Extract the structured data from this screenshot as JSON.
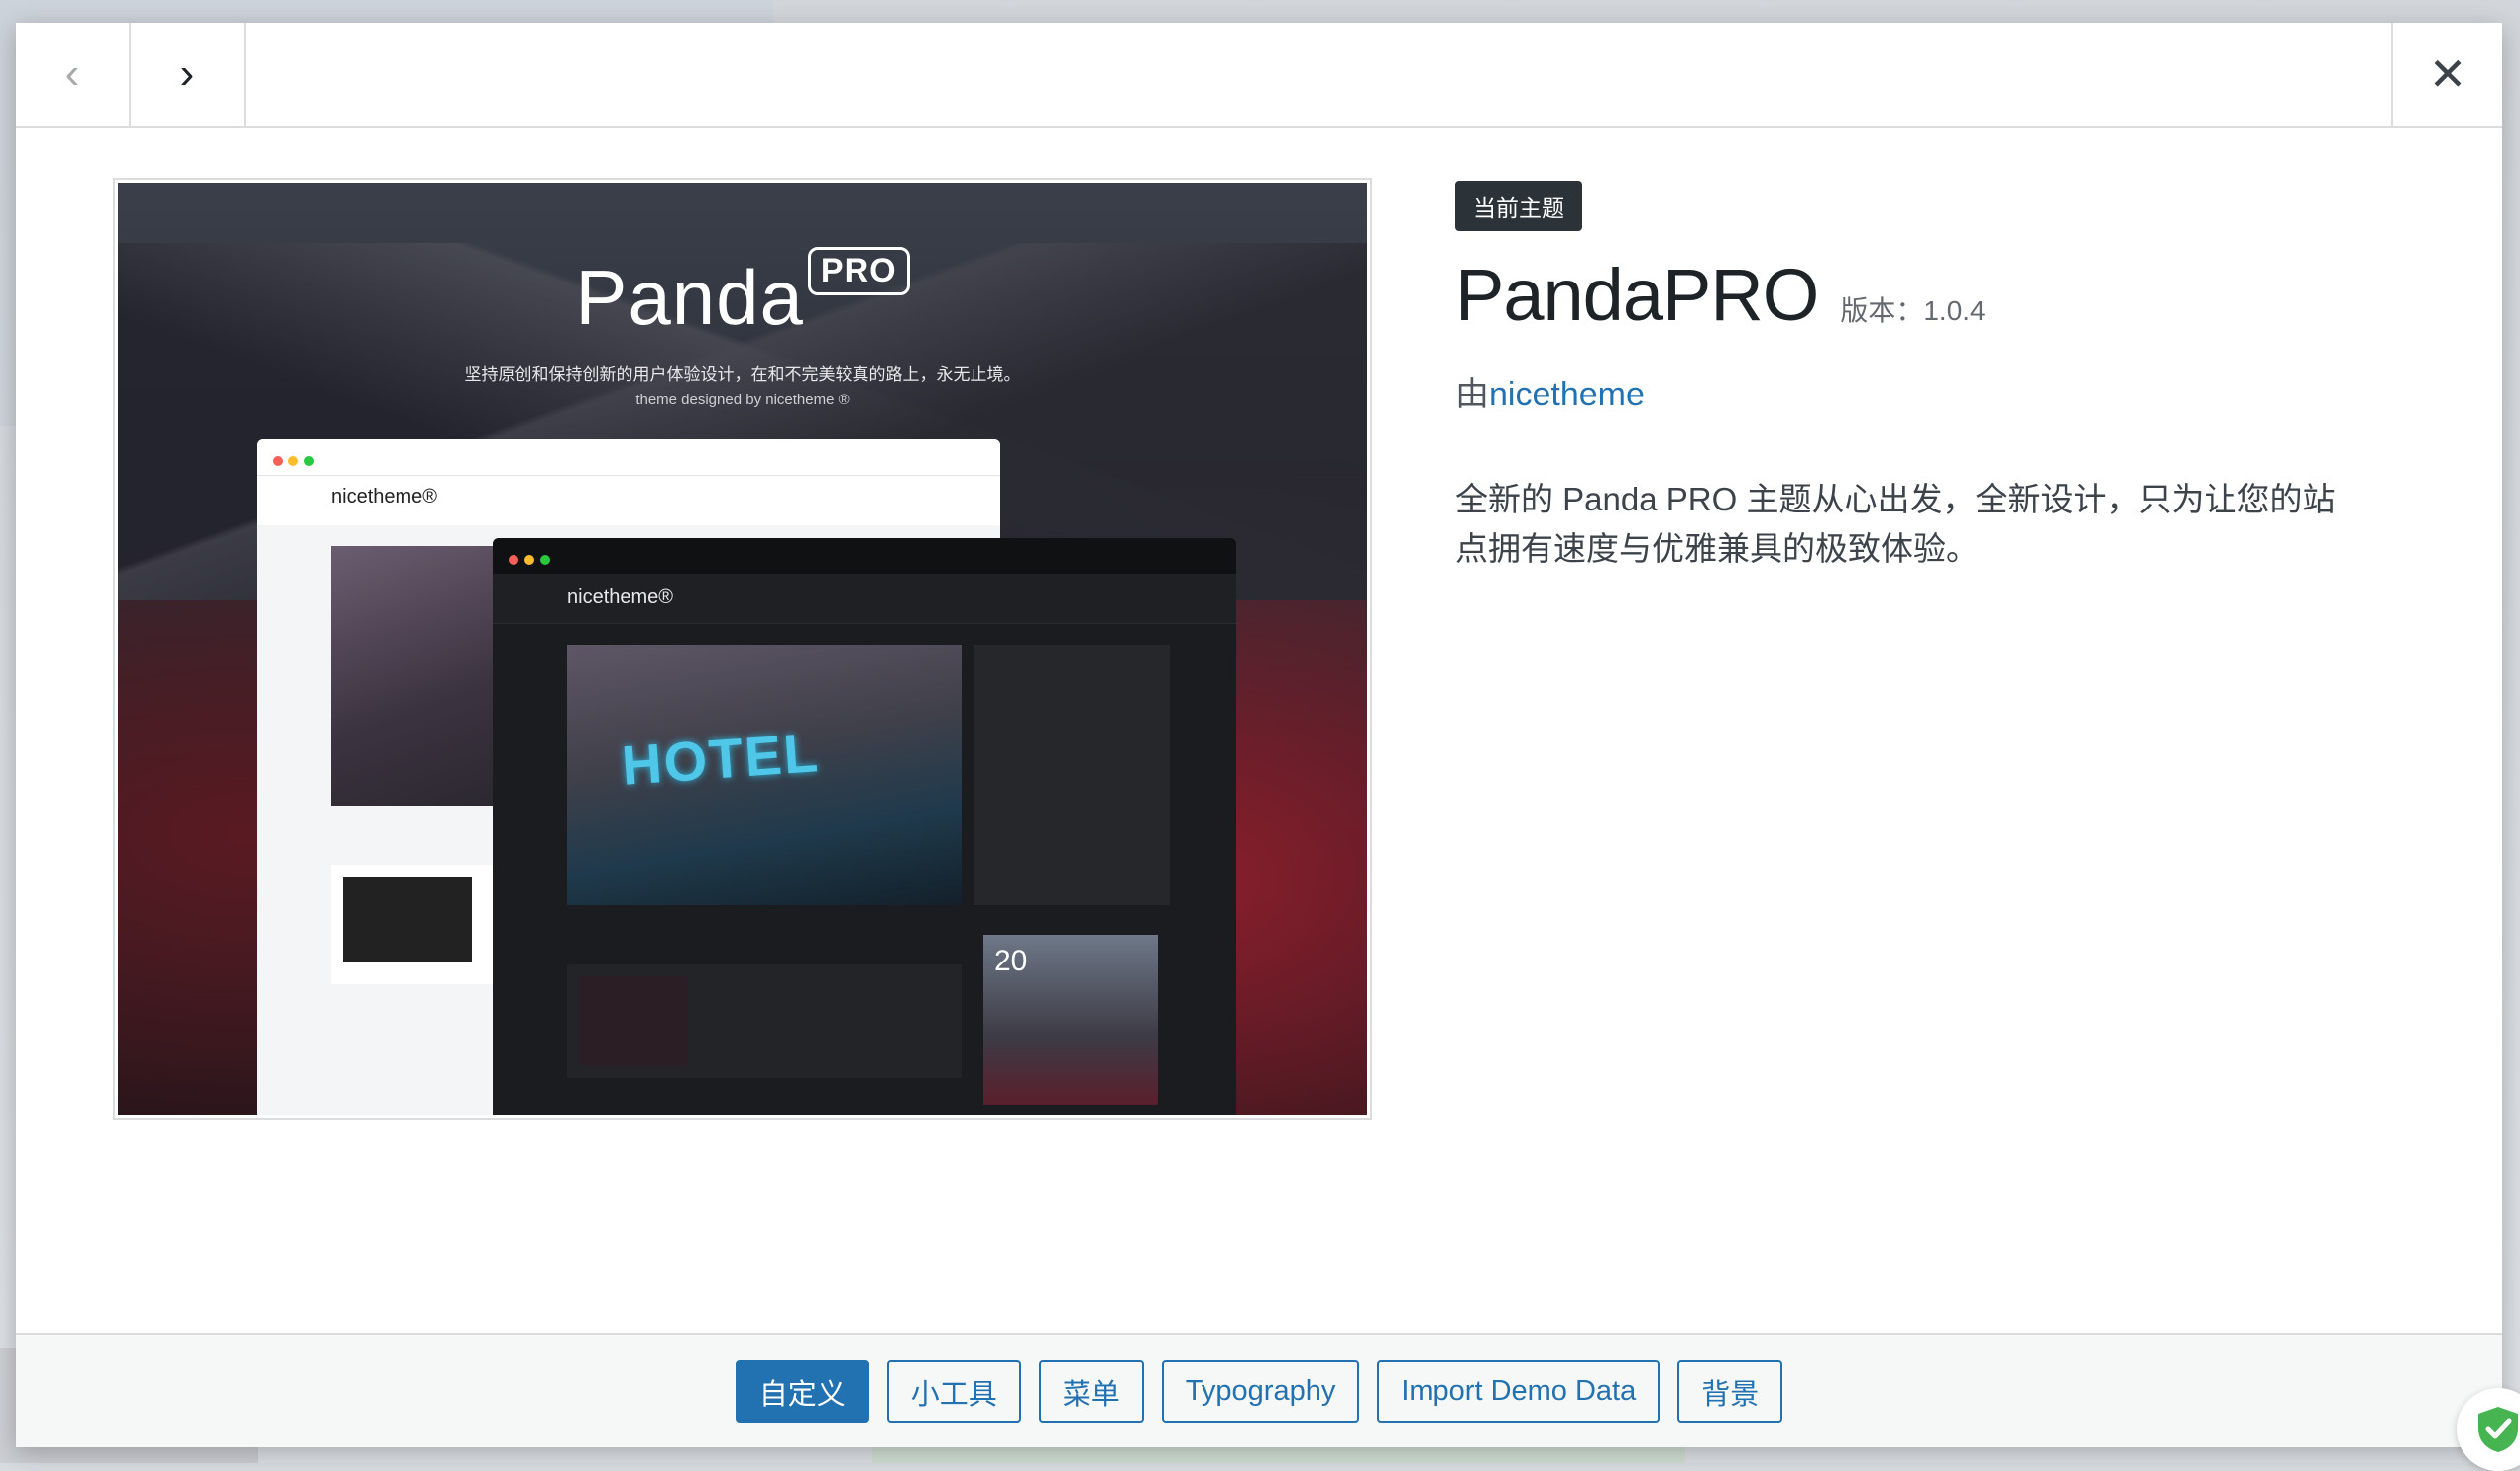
{
  "nav": {
    "prev_icon": "‹",
    "next_icon": "›",
    "close_icon": "✕"
  },
  "screenshot": {
    "brand": "Panda",
    "brand_badge": "PRO",
    "tagline": "坚持原创和保持创新的用户体验设计，在和不完美较真的路上，永无止境。",
    "credit": "theme designed by nicetheme ®",
    "mock_logo_light": "nicetheme®",
    "mock_logo_dark": "nicetheme®",
    "mock_hero_sign": "HOTEL",
    "mock_day": "20"
  },
  "details": {
    "badge": "当前主题",
    "theme_name": "PandaPRO",
    "version": "版本：1.0.4",
    "author_prefix": "由",
    "author_name": "nicetheme",
    "description": "全新的 Panda PRO 主题从心出发，全新设计，只为让您的站点拥有速度与优雅兼具的极致体验。"
  },
  "footer": {
    "buttons": [
      "自定义",
      "小工具",
      "菜单",
      "Typography",
      "Import Demo Data",
      "背景"
    ]
  },
  "colors": {
    "accent": "#2271b1",
    "badge_bg": "#2c3338",
    "shield_green": "#46b450"
  }
}
